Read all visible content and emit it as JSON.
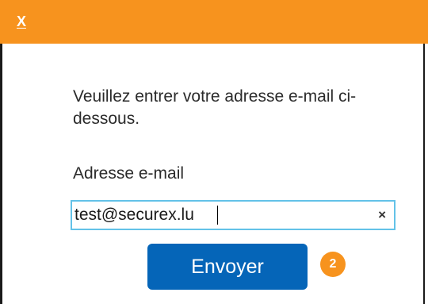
{
  "titlebar": {
    "close_label": "X",
    "color": "#f7931e"
  },
  "form": {
    "instructions": "Veuillez entrer votre adresse e-mail ci-dessous.",
    "email_label": "Adresse e-mail",
    "email_value": "test@securex.lu",
    "clear_label": "×",
    "submit_label": "Envoyer",
    "input_border_color": "#63c2e8",
    "button_color": "#0565b8"
  },
  "annotation": {
    "step_number": "2",
    "color": "#f7931e"
  }
}
